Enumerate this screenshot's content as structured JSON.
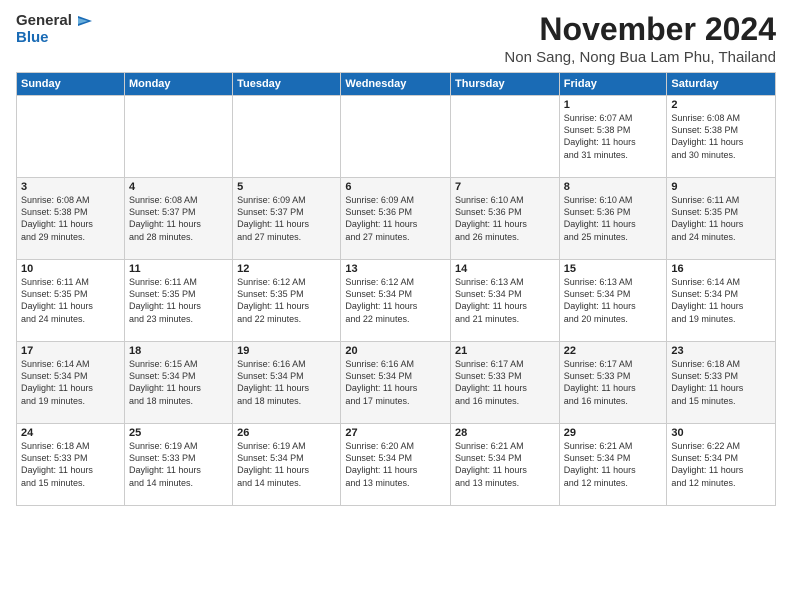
{
  "logo": {
    "line1": "General",
    "line2": "Blue"
  },
  "title": "November 2024",
  "subtitle": "Non Sang, Nong Bua Lam Phu, Thailand",
  "days_header": [
    "Sunday",
    "Monday",
    "Tuesday",
    "Wednesday",
    "Thursday",
    "Friday",
    "Saturday"
  ],
  "weeks": [
    [
      {
        "day": "",
        "info": ""
      },
      {
        "day": "",
        "info": ""
      },
      {
        "day": "",
        "info": ""
      },
      {
        "day": "",
        "info": ""
      },
      {
        "day": "",
        "info": ""
      },
      {
        "day": "1",
        "info": "Sunrise: 6:07 AM\nSunset: 5:38 PM\nDaylight: 11 hours\nand 31 minutes."
      },
      {
        "day": "2",
        "info": "Sunrise: 6:08 AM\nSunset: 5:38 PM\nDaylight: 11 hours\nand 30 minutes."
      }
    ],
    [
      {
        "day": "3",
        "info": "Sunrise: 6:08 AM\nSunset: 5:38 PM\nDaylight: 11 hours\nand 29 minutes."
      },
      {
        "day": "4",
        "info": "Sunrise: 6:08 AM\nSunset: 5:37 PM\nDaylight: 11 hours\nand 28 minutes."
      },
      {
        "day": "5",
        "info": "Sunrise: 6:09 AM\nSunset: 5:37 PM\nDaylight: 11 hours\nand 27 minutes."
      },
      {
        "day": "6",
        "info": "Sunrise: 6:09 AM\nSunset: 5:36 PM\nDaylight: 11 hours\nand 27 minutes."
      },
      {
        "day": "7",
        "info": "Sunrise: 6:10 AM\nSunset: 5:36 PM\nDaylight: 11 hours\nand 26 minutes."
      },
      {
        "day": "8",
        "info": "Sunrise: 6:10 AM\nSunset: 5:36 PM\nDaylight: 11 hours\nand 25 minutes."
      },
      {
        "day": "9",
        "info": "Sunrise: 6:11 AM\nSunset: 5:35 PM\nDaylight: 11 hours\nand 24 minutes."
      }
    ],
    [
      {
        "day": "10",
        "info": "Sunrise: 6:11 AM\nSunset: 5:35 PM\nDaylight: 11 hours\nand 24 minutes."
      },
      {
        "day": "11",
        "info": "Sunrise: 6:11 AM\nSunset: 5:35 PM\nDaylight: 11 hours\nand 23 minutes."
      },
      {
        "day": "12",
        "info": "Sunrise: 6:12 AM\nSunset: 5:35 PM\nDaylight: 11 hours\nand 22 minutes."
      },
      {
        "day": "13",
        "info": "Sunrise: 6:12 AM\nSunset: 5:34 PM\nDaylight: 11 hours\nand 22 minutes."
      },
      {
        "day": "14",
        "info": "Sunrise: 6:13 AM\nSunset: 5:34 PM\nDaylight: 11 hours\nand 21 minutes."
      },
      {
        "day": "15",
        "info": "Sunrise: 6:13 AM\nSunset: 5:34 PM\nDaylight: 11 hours\nand 20 minutes."
      },
      {
        "day": "16",
        "info": "Sunrise: 6:14 AM\nSunset: 5:34 PM\nDaylight: 11 hours\nand 19 minutes."
      }
    ],
    [
      {
        "day": "17",
        "info": "Sunrise: 6:14 AM\nSunset: 5:34 PM\nDaylight: 11 hours\nand 19 minutes."
      },
      {
        "day": "18",
        "info": "Sunrise: 6:15 AM\nSunset: 5:34 PM\nDaylight: 11 hours\nand 18 minutes."
      },
      {
        "day": "19",
        "info": "Sunrise: 6:16 AM\nSunset: 5:34 PM\nDaylight: 11 hours\nand 18 minutes."
      },
      {
        "day": "20",
        "info": "Sunrise: 6:16 AM\nSunset: 5:34 PM\nDaylight: 11 hours\nand 17 minutes."
      },
      {
        "day": "21",
        "info": "Sunrise: 6:17 AM\nSunset: 5:33 PM\nDaylight: 11 hours\nand 16 minutes."
      },
      {
        "day": "22",
        "info": "Sunrise: 6:17 AM\nSunset: 5:33 PM\nDaylight: 11 hours\nand 16 minutes."
      },
      {
        "day": "23",
        "info": "Sunrise: 6:18 AM\nSunset: 5:33 PM\nDaylight: 11 hours\nand 15 minutes."
      }
    ],
    [
      {
        "day": "24",
        "info": "Sunrise: 6:18 AM\nSunset: 5:33 PM\nDaylight: 11 hours\nand 15 minutes."
      },
      {
        "day": "25",
        "info": "Sunrise: 6:19 AM\nSunset: 5:33 PM\nDaylight: 11 hours\nand 14 minutes."
      },
      {
        "day": "26",
        "info": "Sunrise: 6:19 AM\nSunset: 5:34 PM\nDaylight: 11 hours\nand 14 minutes."
      },
      {
        "day": "27",
        "info": "Sunrise: 6:20 AM\nSunset: 5:34 PM\nDaylight: 11 hours\nand 13 minutes."
      },
      {
        "day": "28",
        "info": "Sunrise: 6:21 AM\nSunset: 5:34 PM\nDaylight: 11 hours\nand 13 minutes."
      },
      {
        "day": "29",
        "info": "Sunrise: 6:21 AM\nSunset: 5:34 PM\nDaylight: 11 hours\nand 12 minutes."
      },
      {
        "day": "30",
        "info": "Sunrise: 6:22 AM\nSunset: 5:34 PM\nDaylight: 11 hours\nand 12 minutes."
      }
    ]
  ]
}
